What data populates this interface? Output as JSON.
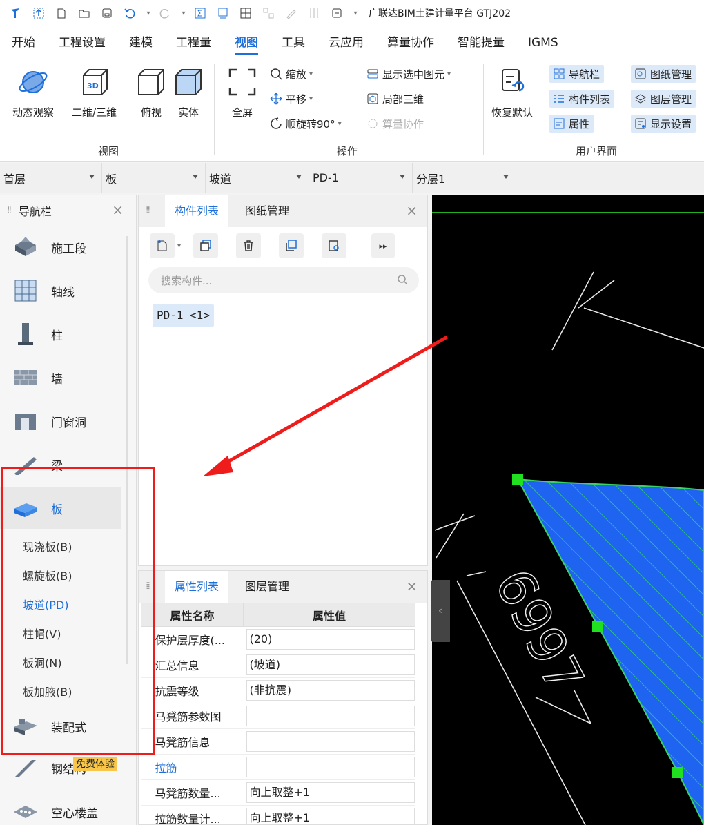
{
  "title_bar": {
    "app_title": "广联达BIM土建计量平台 GTJ202"
  },
  "menu": {
    "items": [
      "开始",
      "工程设置",
      "建模",
      "工程量",
      "视图",
      "工具",
      "云应用",
      "算量协作",
      "智能提量",
      "IGMS"
    ],
    "active_index": 4
  },
  "ribbon": {
    "view_group": {
      "label": "视图",
      "buttons": [
        "动态观察",
        "二维/三维",
        "俯视",
        "实体"
      ]
    },
    "operate_group": {
      "label": "操作",
      "fullscreen": "全屏",
      "zoom": "缩放",
      "pan": "平移",
      "rotate": "顺旋转90°",
      "show_selected": "显示选中图元",
      "local_3d": "局部三维",
      "collab": "算量协作"
    },
    "ui_group": {
      "label": "用户界面",
      "restore": "恢复默认",
      "nav": "导航栏",
      "comp_list": "构件列表",
      "attr": "属性",
      "drawing_mgmt": "图纸管理",
      "layer_mgmt": "图层管理",
      "display_settings": "显示设置"
    }
  },
  "selectors": {
    "floor": "首层",
    "type": "板",
    "subtype": "坡道",
    "component": "PD-1",
    "layer": "分层1"
  },
  "nav_panel": {
    "title": "导航栏",
    "items": [
      "施工段",
      "轴线",
      "柱",
      "墙",
      "门窗洞",
      "梁",
      "板"
    ],
    "sub_items": [
      "现浇板(B)",
      "螺旋板(B)",
      "坡道(PD)",
      "柱帽(V)",
      "板洞(N)",
      "板加腋(B)"
    ],
    "after_items": [
      "装配式",
      "钢结构",
      "空心楼盖"
    ],
    "free_badge": "免费体验"
  },
  "component_panel": {
    "tabs": [
      "构件列表",
      "图纸管理"
    ],
    "search_placeholder": "搜索构件...",
    "items": [
      "PD-1 <1>"
    ]
  },
  "property_panel": {
    "tabs": [
      "属性列表",
      "图层管理"
    ],
    "headers": [
      "属性名称",
      "属性值"
    ],
    "rows": [
      {
        "name": "保护层厚度(...",
        "value": "(20)"
      },
      {
        "name": "汇总信息",
        "value": "(坡道)"
      },
      {
        "name": "抗震等级",
        "value": "(非抗震)"
      },
      {
        "name": "马凳筋参数图",
        "value": ""
      },
      {
        "name": "马凳筋信息",
        "value": ""
      },
      {
        "name": "拉筋",
        "value": ""
      },
      {
        "name": "马凳筋数量...",
        "value": "向上取整+1"
      },
      {
        "name": "拉筋数量计...",
        "value": "向上取整+1"
      }
    ]
  },
  "canvas": {
    "text": "6997"
  }
}
